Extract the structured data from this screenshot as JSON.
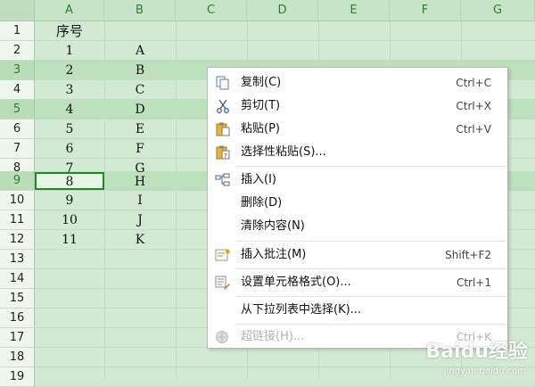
{
  "columns": [
    "A",
    "B",
    "C",
    "D",
    "E",
    "F",
    "G"
  ],
  "rows": [
    "1",
    "2",
    "3",
    "4",
    "5",
    "6",
    "7",
    "8",
    "9",
    "10",
    "11",
    "12",
    "13",
    "14",
    "15",
    "16",
    "17",
    "18",
    "19"
  ],
  "cells": {
    "A1": "序号",
    "A": [
      "1",
      "2",
      "3",
      "4",
      "5",
      "6",
      "7",
      "8",
      "9",
      "10",
      "11"
    ],
    "B": [
      "A",
      "B",
      "C",
      "D",
      "E",
      "F",
      "G",
      "H",
      "I",
      "J",
      "K"
    ]
  },
  "context_menu": {
    "items": [
      {
        "label": "复制(C)",
        "shortcut": "Ctrl+C",
        "icon": "copy-icon"
      },
      {
        "label": "剪切(T)",
        "shortcut": "Ctrl+X",
        "icon": "scissors-icon"
      },
      {
        "label": "粘贴(P)",
        "shortcut": "Ctrl+V",
        "icon": "paste-icon"
      },
      {
        "label": "选择性粘贴(S)...",
        "shortcut": "",
        "icon": "paste-special-icon"
      },
      {
        "label": "插入(I)",
        "shortcut": "",
        "icon": "insert-icon"
      },
      {
        "label": "删除(D)",
        "shortcut": "",
        "icon": ""
      },
      {
        "label": "清除内容(N)",
        "shortcut": "",
        "icon": ""
      },
      {
        "label": "插入批注(M)",
        "shortcut": "Shift+F2",
        "icon": "comment-icon"
      },
      {
        "label": "设置单元格格式(O)...",
        "shortcut": "Ctrl+1",
        "icon": "format-cells-icon"
      },
      {
        "label": "从下拉列表中选择(K)...",
        "shortcut": "",
        "icon": ""
      },
      {
        "label": "超链接(H)...",
        "shortcut": "Ctrl+K",
        "icon": "hyperlink-icon",
        "disabled": true
      }
    ]
  },
  "watermark": {
    "brand": "Baidu经验",
    "url": "jingyan.baidu.com"
  },
  "colors": {
    "accent": "#1f8a1f",
    "grid_bg": "#d2ead2",
    "selected_row": "#bde0bd"
  }
}
